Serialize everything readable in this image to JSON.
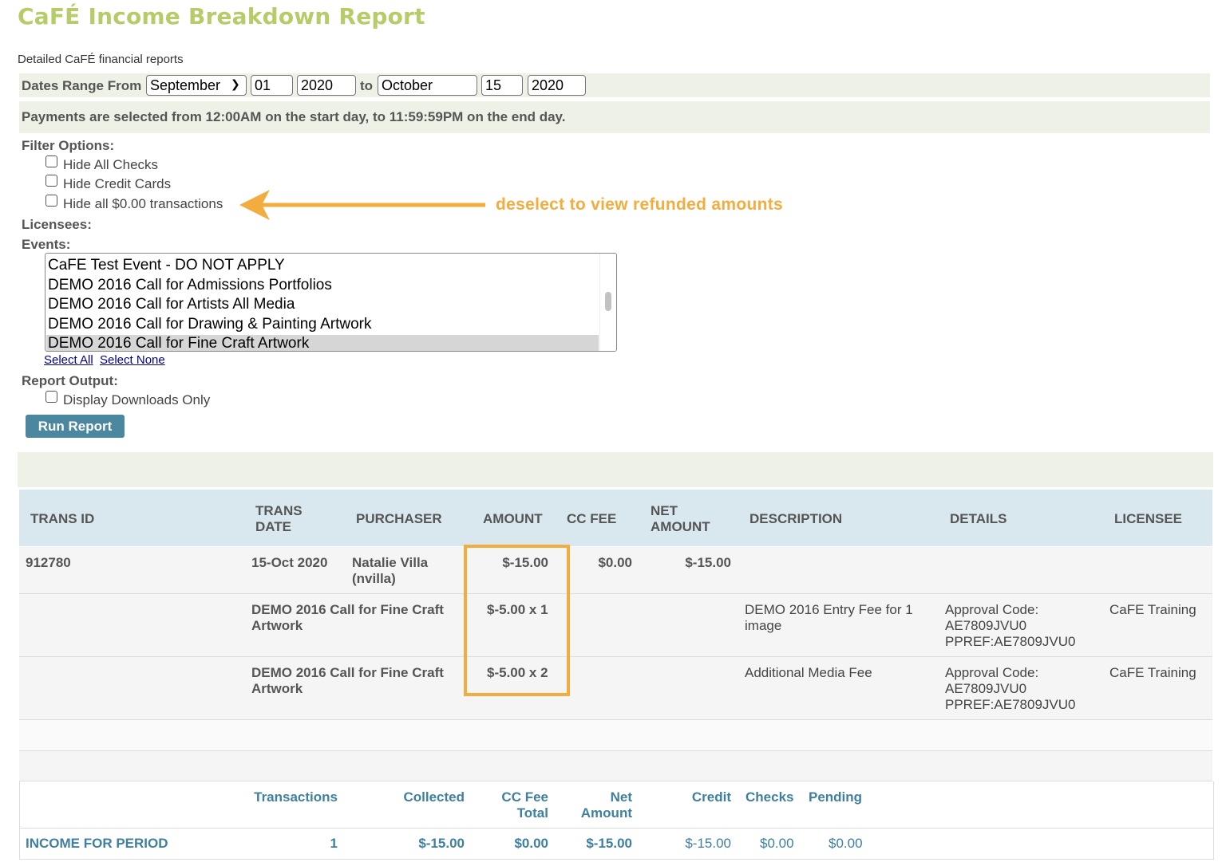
{
  "page": {
    "title": "CaFÉ Income Breakdown Report",
    "subtitle": "Detailed CaFÉ financial reports"
  },
  "date_range": {
    "label_from": "Dates Range From",
    "label_to": "to",
    "from_month": "September",
    "from_day": "01",
    "from_year": "2020",
    "to_month": "October",
    "to_day": "15",
    "to_year": "2020",
    "note": "Payments are selected from 12:00AM on the start day, to 11:59:59PM on the end day."
  },
  "filters": {
    "label": "Filter Options:",
    "options": [
      {
        "label": "Hide All Checks",
        "checked": false
      },
      {
        "label": "Hide Credit Cards",
        "checked": false
      },
      {
        "label": "Hide all $0.00 transactions",
        "checked": false
      }
    ],
    "annotation": "deselect to view refunded amounts"
  },
  "licensees": {
    "label": "Licensees:"
  },
  "events": {
    "label": "Events:",
    "items": [
      "CaFE Test Event - DO NOT APPLY",
      "DEMO 2016 Call for Admissions Portfolios",
      "DEMO 2016 Call for Artists All Media",
      "DEMO 2016 Call for Drawing & Painting Artwork",
      "DEMO 2016 Call for Fine Craft Artwork"
    ],
    "selected_index": 4,
    "select_all": "Select All",
    "select_none": "Select None"
  },
  "report_output": {
    "label": "Report Output:",
    "display_downloads_only": "Display Downloads Only",
    "checked": false
  },
  "run_button": "Run Report",
  "table": {
    "headers": {
      "trans_id": "TRANS ID",
      "trans_date_1": "TRANS",
      "trans_date_2": "DATE",
      "purchaser": "PURCHASER",
      "amount": "AMOUNT",
      "cc_fee": "CC FEE",
      "net_amount_1": "NET",
      "net_amount_2": "AMOUNT",
      "description": "DESCRIPTION",
      "details": "DETAILS",
      "licensee": "LICENSEE"
    },
    "transaction": {
      "id": "912780",
      "date": "15-Oct 2020",
      "purchaser_name": "Natalie Villa",
      "purchaser_user": "(nvilla)",
      "amount": "$-15.00",
      "cc_fee": "$0.00",
      "net_amount": "$-15.00"
    },
    "line_items": [
      {
        "event_1": "DEMO 2016 Call for Fine Craft",
        "event_2": "Artwork",
        "amount": "$-5.00 x 1",
        "description_1": "DEMO 2016 Entry Fee for 1",
        "description_2": "image",
        "details_1": "Approval Code:",
        "details_2": "AE7809JVU0",
        "details_3": "PPREF:AE7809JVU0",
        "licensee": "CaFE Training"
      },
      {
        "event_1": "DEMO 2016 Call for Fine Craft",
        "event_2": "Artwork",
        "amount": "$-5.00 x 2",
        "description_1": "Additional Media Fee",
        "description_2": "",
        "details_1": "Approval Code:",
        "details_2": "AE7809JVU0",
        "details_3": "PPREF:AE7809JVU0",
        "licensee": "CaFE Training"
      }
    ]
  },
  "summary": {
    "headers": {
      "transactions": "Transactions",
      "collected": "Collected",
      "cc_fee_1": "CC Fee",
      "cc_fee_2": "Total",
      "net_1": "Net",
      "net_2": "Amount",
      "credit": "Credit",
      "checks": "Checks",
      "pending": "Pending"
    },
    "row_label": "INCOME FOR PERIOD",
    "transactions": "1",
    "collected": "$-15.00",
    "cc_fee_total": "$0.00",
    "net_amount": "$-15.00",
    "credit": "$-15.00",
    "checks": "$0.00",
    "pending": "$0.00"
  },
  "colors": {
    "title": "#b5cc68",
    "annotation": "#f3ad3e",
    "header_band": "#d9e8ef",
    "summary_text": "#3f7fa0",
    "button": "#4c87a0"
  }
}
